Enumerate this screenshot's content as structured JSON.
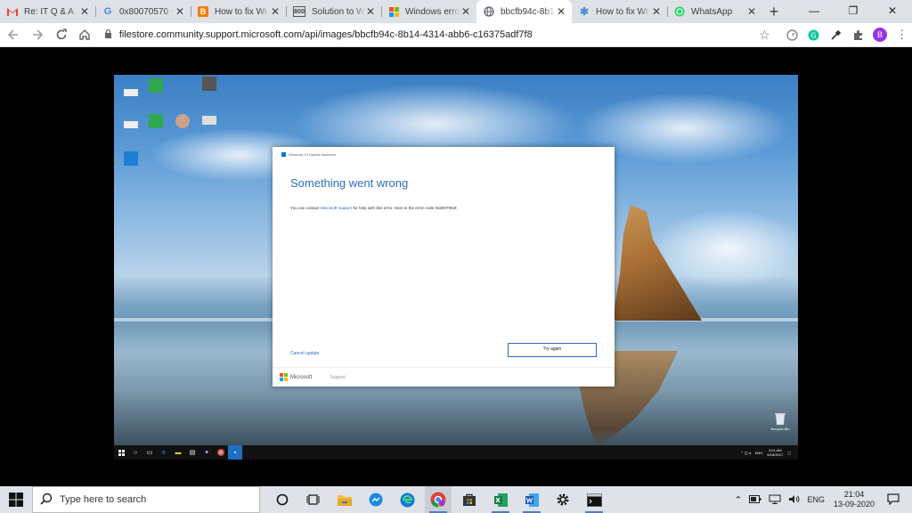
{
  "browser": {
    "tabs": [
      {
        "title": "Re: IT Q & A",
        "icon": "gmail-icon"
      },
      {
        "title": "0x80070570 -",
        "icon": "google-icon"
      },
      {
        "title": "How to fix Wi",
        "icon": "blogger-icon"
      },
      {
        "title": "Solution to Wi",
        "icon": "800-icon",
        "favicon_text": "800"
      },
      {
        "title": "Windows error",
        "icon": "windows-icon"
      },
      {
        "title": "bbcfb94c-8b1",
        "icon": "globe-icon",
        "active": true
      },
      {
        "title": "How to fix Wi",
        "icon": "sparkle-icon"
      },
      {
        "title": "WhatsApp",
        "icon": "whatsapp-icon"
      }
    ],
    "url": "filestore.community.support.microsoft.com/api/images/bbcfb94c-8b14-4314-abb6-c16375adf7f8",
    "profile_initial": "B"
  },
  "screenshot": {
    "dialog": {
      "title": "Windows 10 Update Assistant",
      "heading": "Something went wrong",
      "message_before": "You can contact ",
      "message_link": "Microsoft support",
      "message_after": " for help with this error. Here is the error code 0x8007054f.",
      "cancel_label": "Cancel update",
      "retry_label": "Try again",
      "footer_brand": "Microsoft",
      "footer_support": "Support"
    },
    "recycle_bin_label": "Recycle Bin",
    "inner_clock_time": "3:01 AM",
    "inner_clock_date": "6/15/2017",
    "inner_lang": "ENG"
  },
  "taskbar": {
    "search_placeholder": "Type here to search",
    "language": "ENG",
    "time": "21:04",
    "date": "13-09-2020"
  },
  "colors": {
    "accent_blue": "#2b6cbf",
    "taskbar_bg": "#dfe3e9",
    "tabstrip_bg": "#dee1e6"
  }
}
